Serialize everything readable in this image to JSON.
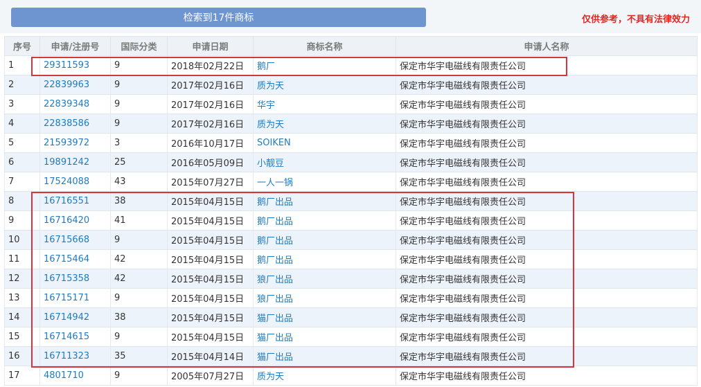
{
  "search_button_label": "检索到17件商标",
  "disclaimer": "仅供参考，不具有法律效力",
  "columns": [
    "序号",
    "申请/注册号",
    "国际分类",
    "申请日期",
    "商标名称",
    "申请人名称"
  ],
  "rows": [
    {
      "no": "1",
      "reg": "29311593",
      "cls": "9",
      "date": "2018年02月22日",
      "mark": "鹅厂",
      "applicant": "保定市华宇电磁线有限责任公司"
    },
    {
      "no": "2",
      "reg": "22839963",
      "cls": "9",
      "date": "2017年02月16日",
      "mark": "质为天",
      "applicant": "保定市华宇电磁线有限责任公司"
    },
    {
      "no": "3",
      "reg": "22839348",
      "cls": "9",
      "date": "2017年02月16日",
      "mark": "华宇",
      "applicant": "保定市华宇电磁线有限责任公司"
    },
    {
      "no": "4",
      "reg": "22838586",
      "cls": "9",
      "date": "2017年02月16日",
      "mark": "质为天",
      "applicant": "保定市华宇电磁线有限责任公司"
    },
    {
      "no": "5",
      "reg": "21593972",
      "cls": "3",
      "date": "2016年10月17日",
      "mark": "SOIKEN",
      "applicant": "保定市华宇电磁线有限责任公司"
    },
    {
      "no": "6",
      "reg": "19891242",
      "cls": "25",
      "date": "2016年05月09日",
      "mark": "小靓豆",
      "applicant": "保定市华宇电磁线有限责任公司"
    },
    {
      "no": "7",
      "reg": "17524088",
      "cls": "43",
      "date": "2015年07月27日",
      "mark": "一人一锅",
      "applicant": "保定市华宇电磁线有限责任公司"
    },
    {
      "no": "8",
      "reg": "16716551",
      "cls": "38",
      "date": "2015年04月15日",
      "mark": "鹅厂出品",
      "applicant": "保定市华宇电磁线有限责任公司"
    },
    {
      "no": "9",
      "reg": "16716420",
      "cls": "41",
      "date": "2015年04月15日",
      "mark": "鹅厂出品",
      "applicant": "保定市华宇电磁线有限责任公司"
    },
    {
      "no": "10",
      "reg": "16715668",
      "cls": "9",
      "date": "2015年04月15日",
      "mark": "鹅厂出品",
      "applicant": "保定市华宇电磁线有限责任公司"
    },
    {
      "no": "11",
      "reg": "16715464",
      "cls": "42",
      "date": "2015年04月15日",
      "mark": "鹅厂出品",
      "applicant": "保定市华宇电磁线有限责任公司"
    },
    {
      "no": "12",
      "reg": "16715358",
      "cls": "42",
      "date": "2015年04月15日",
      "mark": "狼厂出品",
      "applicant": "保定市华宇电磁线有限责任公司"
    },
    {
      "no": "13",
      "reg": "16715171",
      "cls": "9",
      "date": "2015年04月15日",
      "mark": "狼厂出品",
      "applicant": "保定市华宇电磁线有限责任公司"
    },
    {
      "no": "14",
      "reg": "16714942",
      "cls": "38",
      "date": "2015年04月15日",
      "mark": "猫厂出品",
      "applicant": "保定市华宇电磁线有限责任公司"
    },
    {
      "no": "15",
      "reg": "16714615",
      "cls": "9",
      "date": "2015年04月15日",
      "mark": "猫厂出品",
      "applicant": "保定市华宇电磁线有限责任公司"
    },
    {
      "no": "16",
      "reg": "16711323",
      "cls": "35",
      "date": "2015年04月14日",
      "mark": "猫厂出品",
      "applicant": "保定市华宇电磁线有限责任公司"
    },
    {
      "no": "17",
      "reg": "4801710",
      "cls": "9",
      "date": "2005年07月27日",
      "mark": "质为天",
      "applicant": "保定市华宇电磁线有限责任公司"
    }
  ],
  "colors": {
    "accent_button": "#6e95d0",
    "link": "#1f7bc1",
    "disclaimer": "#e0281f",
    "highlight_box": "#d9343a"
  }
}
